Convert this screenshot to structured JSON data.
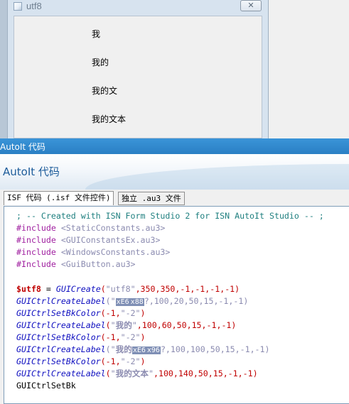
{
  "utf8_window": {
    "title": "utf8",
    "close_glyph": "✕",
    "labels": [
      "我",
      "我的",
      "我的文",
      "我的文本"
    ]
  },
  "main_window": {
    "title": "AutoIt 代码",
    "heading": "AutoIt 代码"
  },
  "tabs": [
    {
      "label": "ISF 代码 (.isf 文件控件)",
      "active": true
    },
    {
      "label": "独立 .au3 文件",
      "active": false
    }
  ],
  "code_lines": [
    {
      "segments": [
        {
          "t": "; -- Created with ISN Form Studio 2 for ISN AutoIt Studio -- ;",
          "c": "c-comment"
        }
      ]
    },
    {
      "segments": [
        {
          "t": "#include ",
          "c": "c-pre"
        },
        {
          "t": "<StaticConstants.au3>",
          "c": "c-inc"
        }
      ]
    },
    {
      "segments": [
        {
          "t": "#include ",
          "c": "c-pre"
        },
        {
          "t": "<GUIConstantsEx.au3>",
          "c": "c-inc"
        }
      ]
    },
    {
      "segments": [
        {
          "t": "#include ",
          "c": "c-pre"
        },
        {
          "t": "<WindowsConstants.au3>",
          "c": "c-inc"
        }
      ]
    },
    {
      "segments": [
        {
          "t": "#Include ",
          "c": "c-pre"
        },
        {
          "t": "<GuiButton.au3>",
          "c": "c-inc"
        }
      ]
    },
    {
      "segments": [
        {
          "t": "",
          "c": "c-plain"
        }
      ]
    },
    {
      "segments": [
        {
          "t": "$utf8",
          "c": "c-var"
        },
        {
          "t": " = ",
          "c": "c-op"
        },
        {
          "t": "GUICreate",
          "c": "c-func"
        },
        {
          "t": "(",
          "c": "c-num"
        },
        {
          "t": "\"utf8\"",
          "c": "c-str"
        },
        {
          "t": ",350,350,-1,-1,-1,-1)",
          "c": "c-num"
        }
      ]
    },
    {
      "segments": [
        {
          "t": "GUICtrlCreateLabel",
          "c": "c-func"
        },
        {
          "t": "(\"",
          "c": "c-str"
        },
        {
          "t": "xE6",
          "c": "c-esc"
        },
        {
          "t": "x88",
          "c": "c-esc"
        },
        {
          "t": "?,100,20,50,15,-1,-1)",
          "c": "c-num2"
        }
      ]
    },
    {
      "segments": [
        {
          "t": "GUICtrlSetBkColor",
          "c": "c-func"
        },
        {
          "t": "(-1,",
          "c": "c-num"
        },
        {
          "t": "\"-2\"",
          "c": "c-str"
        },
        {
          "t": ")",
          "c": "c-num"
        }
      ]
    },
    {
      "segments": [
        {
          "t": "GUICtrlCreateLabel",
          "c": "c-func"
        },
        {
          "t": "(",
          "c": "c-num"
        },
        {
          "t": "\"",
          "c": "c-str"
        },
        {
          "t": "我的",
          "c": "c-cjk"
        },
        {
          "t": "\"",
          "c": "c-str"
        },
        {
          "t": ",100,60,50,15,-1,-1)",
          "c": "c-num"
        }
      ]
    },
    {
      "segments": [
        {
          "t": "GUICtrlSetBkColor",
          "c": "c-func"
        },
        {
          "t": "(-1,",
          "c": "c-num"
        },
        {
          "t": "\"-2\"",
          "c": "c-str"
        },
        {
          "t": ")",
          "c": "c-num"
        }
      ]
    },
    {
      "segments": [
        {
          "t": "GUICtrlCreateLabel",
          "c": "c-func"
        },
        {
          "t": "(\"",
          "c": "c-str"
        },
        {
          "t": "我的",
          "c": "c-cjk"
        },
        {
          "t": "xE6",
          "c": "c-esc"
        },
        {
          "t": "x96",
          "c": "c-esc"
        },
        {
          "t": "?,100,100,50,15,-1,-1)",
          "c": "c-num2"
        }
      ]
    },
    {
      "segments": [
        {
          "t": "GUICtrlSetBkColor",
          "c": "c-func"
        },
        {
          "t": "(-1,",
          "c": "c-num"
        },
        {
          "t": "\"-2\"",
          "c": "c-str"
        },
        {
          "t": ")",
          "c": "c-num"
        }
      ]
    },
    {
      "segments": [
        {
          "t": "GUICtrlCreateLabel",
          "c": "c-func"
        },
        {
          "t": "(",
          "c": "c-num"
        },
        {
          "t": "\"",
          "c": "c-str"
        },
        {
          "t": "我的文本",
          "c": "c-cjk"
        },
        {
          "t": "\"",
          "c": "c-str"
        },
        {
          "t": ",100,140,50,15,-1,-1)",
          "c": "c-num"
        }
      ]
    },
    {
      "segments": [
        {
          "t": "GUICtrlSetBk",
          "c": "c-plain"
        }
      ]
    }
  ],
  "colors": {
    "titlebar": "#2a7fc4",
    "heading": "#1d5c9a",
    "comment": "#1e7f7f",
    "preprocessor": "#a020a0",
    "function": "#1010c0",
    "number": "#c00000"
  }
}
